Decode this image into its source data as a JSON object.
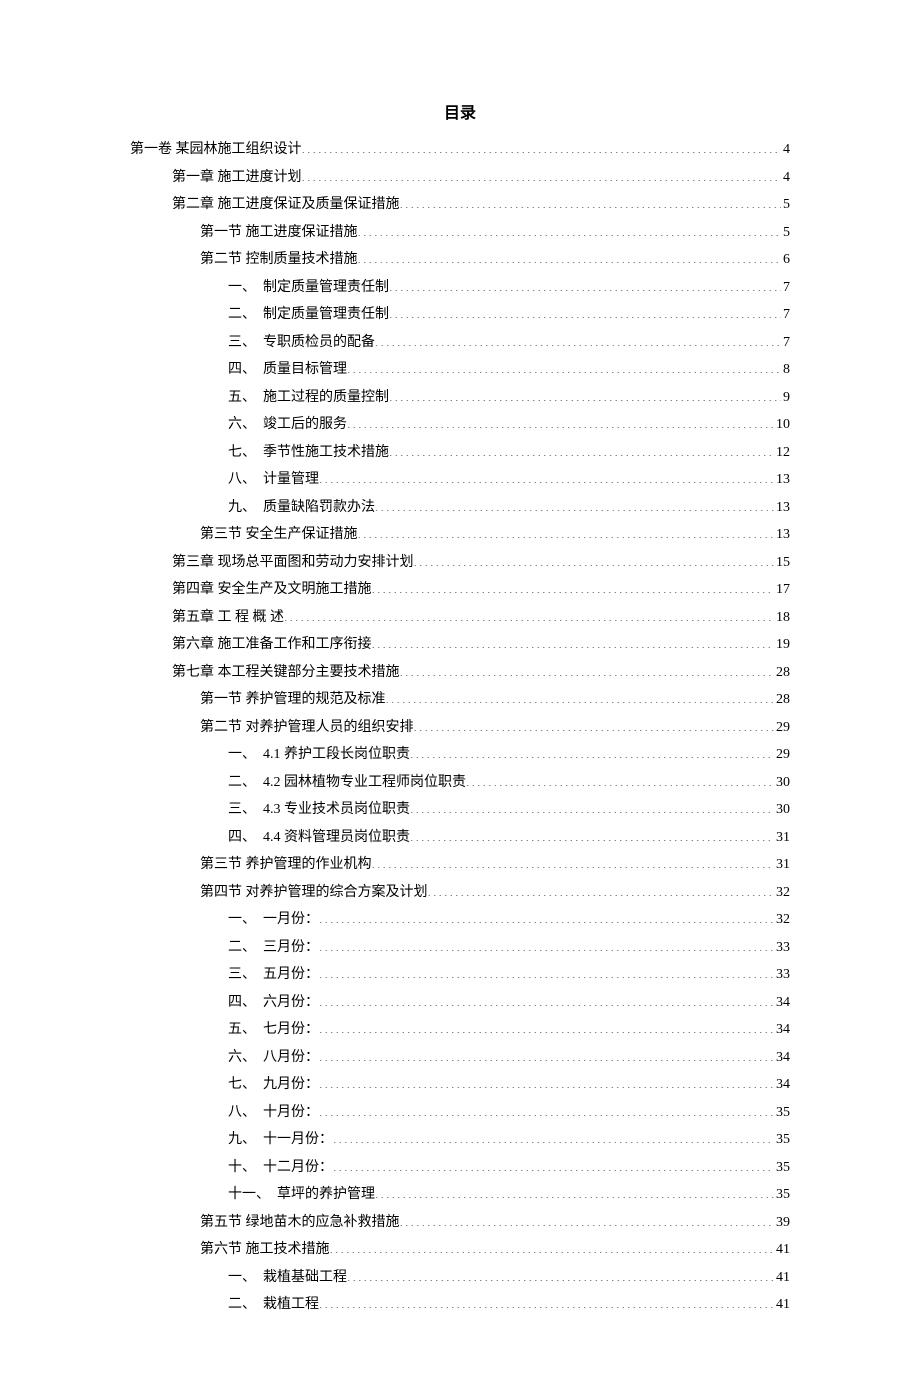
{
  "title": "目录",
  "entries": [
    {
      "indent": 0,
      "label": "第一卷 某园林施工组织设计",
      "page": "4"
    },
    {
      "indent": 1,
      "label": "第一章 施工进度计划",
      "page": "4"
    },
    {
      "indent": 1,
      "label": "第二章 施工进度保证及质量保证措施",
      "page": "5"
    },
    {
      "indent": 2,
      "label": "第一节 施工进度保证措施",
      "page": "5"
    },
    {
      "indent": 2,
      "label": "第二节 控制质量技术措施",
      "page": "6"
    },
    {
      "indent": 3,
      "label": "一、　制定质量管理责任制",
      "page": "7"
    },
    {
      "indent": 3,
      "label": "二、　制定质量管理责任制",
      "page": "7"
    },
    {
      "indent": 3,
      "label": "三、　专职质检员的配备",
      "page": "7"
    },
    {
      "indent": 3,
      "label": "四、　质量目标管理",
      "page": "8"
    },
    {
      "indent": 3,
      "label": "五、　施工过程的质量控制",
      "page": "9"
    },
    {
      "indent": 3,
      "label": "六、　竣工后的服务",
      "page": "10"
    },
    {
      "indent": 3,
      "label": "七、　季节性施工技术措施",
      "page": "12"
    },
    {
      "indent": 3,
      "label": "八、　计量管理",
      "page": "13"
    },
    {
      "indent": 3,
      "label": "九、　质量缺陷罚款办法",
      "page": "13"
    },
    {
      "indent": 2,
      "label": "第三节 安全生产保证措施",
      "page": "13"
    },
    {
      "indent": 1,
      "label": "第三章 现场总平面图和劳动力安排计划",
      "page": "15"
    },
    {
      "indent": 1,
      "label": "第四章 安全生产及文明施工措施",
      "page": "17"
    },
    {
      "indent": 1,
      "label": "第五章 工 程 概 述",
      "page": "18"
    },
    {
      "indent": 1,
      "label": "第六章 施工准备工作和工序衔接",
      "page": "19"
    },
    {
      "indent": 1,
      "label": "第七章 本工程关键部分主要技术措施",
      "page": "28"
    },
    {
      "indent": 2,
      "label": "第一节 养护管理的规范及标准",
      "page": "28"
    },
    {
      "indent": 2,
      "label": "第二节 对养护管理人员的组织安排",
      "page": "29"
    },
    {
      "indent": 3,
      "label": "一、　4.1 养护工段长岗位职责",
      "page": "29"
    },
    {
      "indent": 3,
      "label": "二、　4.2 园林植物专业工程师岗位职责",
      "page": "30"
    },
    {
      "indent": 3,
      "label": "三、　4.3 专业技术员岗位职责",
      "page": "30"
    },
    {
      "indent": 3,
      "label": "四、　4.4 资料管理员岗位职责",
      "page": "31"
    },
    {
      "indent": 2,
      "label": "第三节 养护管理的作业机构",
      "page": "31"
    },
    {
      "indent": 2,
      "label": "第四节 对养护管理的综合方案及计划",
      "page": "32"
    },
    {
      "indent": 3,
      "label": "一、　一月份：",
      "page": "32"
    },
    {
      "indent": 3,
      "label": "二、　三月份：",
      "page": "33"
    },
    {
      "indent": 3,
      "label": "三、　五月份：",
      "page": "33"
    },
    {
      "indent": 3,
      "label": "四、　六月份：",
      "page": "34"
    },
    {
      "indent": 3,
      "label": "五、　七月份：",
      "page": "34"
    },
    {
      "indent": 3,
      "label": "六、　八月份：",
      "page": "34"
    },
    {
      "indent": 3,
      "label": "七、　九月份：",
      "page": "34"
    },
    {
      "indent": 3,
      "label": "八、　十月份：",
      "page": "35"
    },
    {
      "indent": 3,
      "label": "九、　十一月份：",
      "page": "35"
    },
    {
      "indent": 3,
      "label": "十、　十二月份：",
      "page": "35"
    },
    {
      "indent": 3,
      "label": "十一、　草坪的养护管理",
      "page": "35"
    },
    {
      "indent": 2,
      "label": "第五节 绿地苗木的应急补救措施",
      "page": "39"
    },
    {
      "indent": 2,
      "label": "第六节 施工技术措施",
      "page": "41"
    },
    {
      "indent": 3,
      "label": "一、　栽植基础工程",
      "page": "41"
    },
    {
      "indent": 3,
      "label": "二、　栽植工程",
      "page": "41"
    }
  ]
}
